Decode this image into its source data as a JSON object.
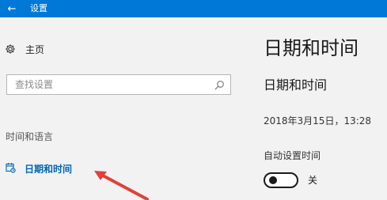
{
  "titlebar": {
    "back_icon": "back-arrow-icon",
    "title": "设置"
  },
  "sidebar": {
    "home": {
      "icon": "gear-icon",
      "label": "主页"
    },
    "search": {
      "placeholder": "查找设置",
      "icon": "search-icon"
    },
    "section_label": "时间和语言",
    "active_item": {
      "icon": "date-time-icon",
      "label": "日期和时间"
    }
  },
  "main": {
    "page_title": "日期和时间",
    "section_heading": "日期和时间",
    "current_datetime": "2018年3月15日，13:28",
    "auto_time": {
      "label": "自动设置时间",
      "state_label": "关",
      "enabled": false
    }
  },
  "colors": {
    "titlebar": "#0078d7",
    "accent": "#0066b4",
    "background": "#f2f2f2",
    "annotation_arrow": "#e0413a"
  },
  "annotation": {
    "icon": "pointer-arrow-icon"
  }
}
